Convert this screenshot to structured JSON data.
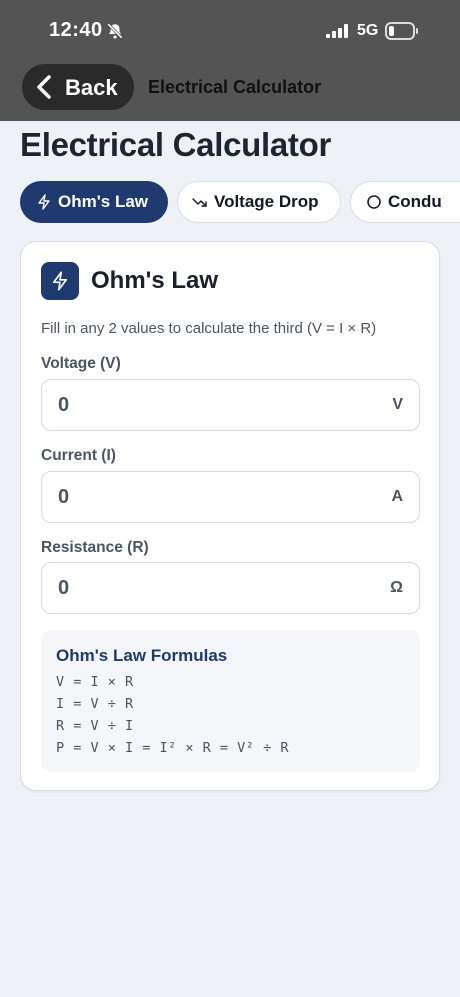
{
  "status_bar": {
    "time": "12:40",
    "network": "5G",
    "icons": [
      "bell-slash-icon",
      "signal-icon",
      "battery-icon"
    ]
  },
  "nav": {
    "back_label": "Back",
    "title": "Electrical Calculator"
  },
  "page": {
    "title": "Electrical Calculator"
  },
  "tabs": [
    {
      "label": "Ohm's Law",
      "icon": "lightning-icon",
      "active": true
    },
    {
      "label": "Voltage Drop",
      "icon": "trend-down-icon",
      "active": false
    },
    {
      "label": "Condu",
      "icon": "circle-icon",
      "active": false
    }
  ],
  "card": {
    "title": "Ohm's Law",
    "icon": "lightning-icon",
    "description": "Fill in any 2 values to calculate the third (V = I × R)",
    "fields": [
      {
        "label": "Voltage (V)",
        "value": "0",
        "unit": "V"
      },
      {
        "label": "Current (I)",
        "value": "0",
        "unit": "A"
      },
      {
        "label": "Resistance (R)",
        "value": "0",
        "unit": "Ω"
      }
    ],
    "formulas": {
      "title": "Ohm's Law Formulas",
      "lines": [
        "V = I × R",
        "I = V ÷ R",
        "R = V ÷ I",
        "P = V × I = I² × R = V² ÷ R"
      ]
    }
  },
  "colors": {
    "accent": "#1e3a6e",
    "header_bg": "#545454",
    "page_bg": "#eef1f6"
  }
}
